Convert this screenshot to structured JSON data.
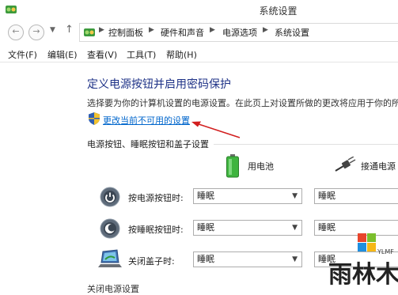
{
  "window": {
    "title": "系统设置"
  },
  "nav": {
    "breadcrumbs": [
      "控制面板",
      "硬件和声音",
      "电源选项",
      "系统设置"
    ]
  },
  "menu": [
    {
      "label": "文件(F)"
    },
    {
      "label": "编辑(E)"
    },
    {
      "label": "查看(V)"
    },
    {
      "label": "工具(T)"
    },
    {
      "label": "帮助(H)"
    }
  ],
  "main": {
    "heading": "定义电源按钮并启用密码保护",
    "description": "选择要为你的计算机设置的电源设置。在此页上对设置所做的更改将应用于你的所",
    "change_link": "更改当前不可用的设置",
    "section_title": "电源按钮、睡眠按钮和盖子设置",
    "columns": [
      "用电池",
      "接通电源"
    ],
    "rows": [
      {
        "label": "按电源按钮时:",
        "battery": "睡眠",
        "plugged": "睡眠"
      },
      {
        "label": "按睡眠按钮时:",
        "battery": "睡眠",
        "plugged": "睡眠"
      },
      {
        "label": "关闭盖子时:",
        "battery": "睡眠",
        "plugged": "睡眠"
      }
    ],
    "next_section_partial": "关闭电源设置"
  },
  "watermark": {
    "text": "雨林木风",
    "subtext": "YLMF"
  },
  "colors": {
    "heading": "#1e3287",
    "link": "#0066cc",
    "arrow": "#d21e1e"
  }
}
